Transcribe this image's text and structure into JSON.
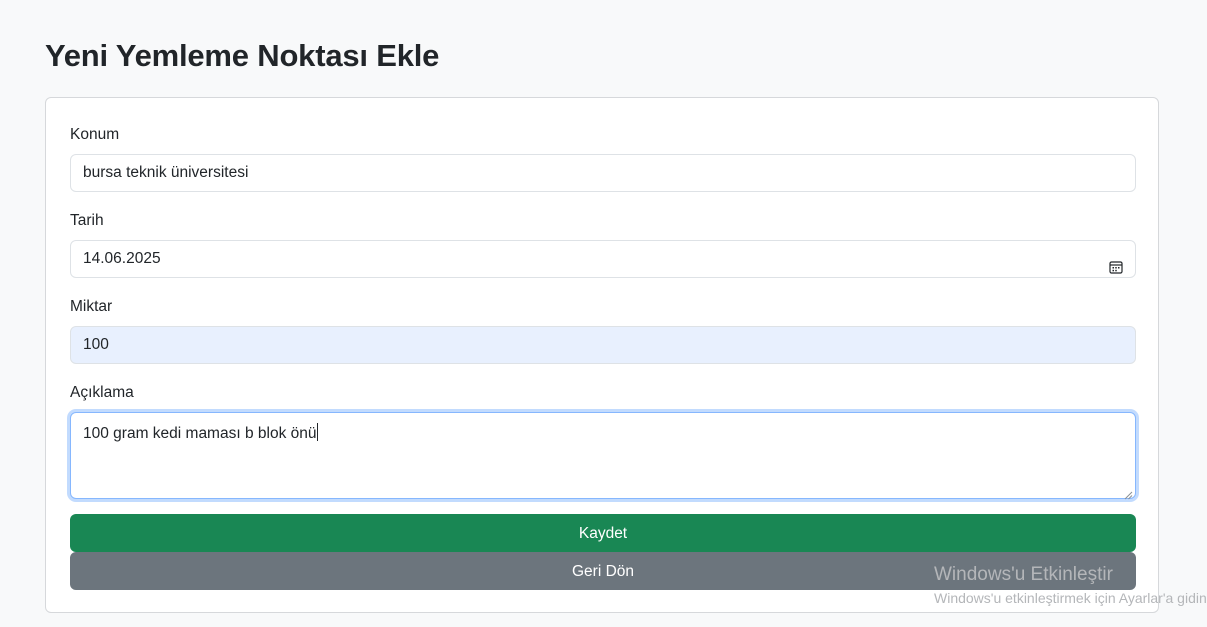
{
  "page": {
    "title": "Yeni Yemleme Noktası Ekle"
  },
  "form": {
    "location": {
      "label": "Konum",
      "value": "bursa teknik üniversitesi"
    },
    "date": {
      "label": "Tarih",
      "value": "14.06.2025",
      "icon": "calendar-icon"
    },
    "amount": {
      "label": "Miktar",
      "value": "100"
    },
    "description": {
      "label": "Açıklama",
      "value": "100 gram kedi maması b blok önü"
    },
    "save_button": "Kaydet",
    "back_button": "Geri Dön"
  },
  "watermark": {
    "title": "Windows'u Etkinleştir",
    "subtitle": "Windows'u etkinleştirmek için Ayarlar'a gidin."
  },
  "colors": {
    "save": "#198754",
    "back": "#6c757d",
    "autofill": "#e8f0fe",
    "focus": "#86b7fe"
  }
}
